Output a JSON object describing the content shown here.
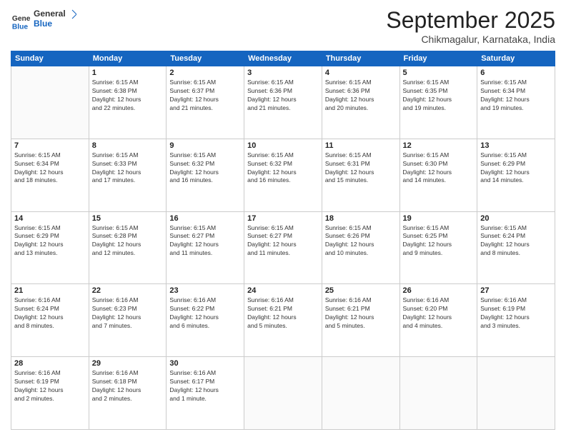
{
  "logo": {
    "line1": "General",
    "line2": "Blue"
  },
  "title": "September 2025",
  "location": "Chikmagalur, Karnataka, India",
  "days_header": [
    "Sunday",
    "Monday",
    "Tuesday",
    "Wednesday",
    "Thursday",
    "Friday",
    "Saturday"
  ],
  "weeks": [
    [
      {
        "day": "",
        "info": ""
      },
      {
        "day": "1",
        "info": "Sunrise: 6:15 AM\nSunset: 6:38 PM\nDaylight: 12 hours\nand 22 minutes."
      },
      {
        "day": "2",
        "info": "Sunrise: 6:15 AM\nSunset: 6:37 PM\nDaylight: 12 hours\nand 21 minutes."
      },
      {
        "day": "3",
        "info": "Sunrise: 6:15 AM\nSunset: 6:36 PM\nDaylight: 12 hours\nand 21 minutes."
      },
      {
        "day": "4",
        "info": "Sunrise: 6:15 AM\nSunset: 6:36 PM\nDaylight: 12 hours\nand 20 minutes."
      },
      {
        "day": "5",
        "info": "Sunrise: 6:15 AM\nSunset: 6:35 PM\nDaylight: 12 hours\nand 19 minutes."
      },
      {
        "day": "6",
        "info": "Sunrise: 6:15 AM\nSunset: 6:34 PM\nDaylight: 12 hours\nand 19 minutes."
      }
    ],
    [
      {
        "day": "7",
        "info": "Sunrise: 6:15 AM\nSunset: 6:34 PM\nDaylight: 12 hours\nand 18 minutes."
      },
      {
        "day": "8",
        "info": "Sunrise: 6:15 AM\nSunset: 6:33 PM\nDaylight: 12 hours\nand 17 minutes."
      },
      {
        "day": "9",
        "info": "Sunrise: 6:15 AM\nSunset: 6:32 PM\nDaylight: 12 hours\nand 16 minutes."
      },
      {
        "day": "10",
        "info": "Sunrise: 6:15 AM\nSunset: 6:32 PM\nDaylight: 12 hours\nand 16 minutes."
      },
      {
        "day": "11",
        "info": "Sunrise: 6:15 AM\nSunset: 6:31 PM\nDaylight: 12 hours\nand 15 minutes."
      },
      {
        "day": "12",
        "info": "Sunrise: 6:15 AM\nSunset: 6:30 PM\nDaylight: 12 hours\nand 14 minutes."
      },
      {
        "day": "13",
        "info": "Sunrise: 6:15 AM\nSunset: 6:29 PM\nDaylight: 12 hours\nand 14 minutes."
      }
    ],
    [
      {
        "day": "14",
        "info": "Sunrise: 6:15 AM\nSunset: 6:29 PM\nDaylight: 12 hours\nand 13 minutes."
      },
      {
        "day": "15",
        "info": "Sunrise: 6:15 AM\nSunset: 6:28 PM\nDaylight: 12 hours\nand 12 minutes."
      },
      {
        "day": "16",
        "info": "Sunrise: 6:15 AM\nSunset: 6:27 PM\nDaylight: 12 hours\nand 11 minutes."
      },
      {
        "day": "17",
        "info": "Sunrise: 6:15 AM\nSunset: 6:27 PM\nDaylight: 12 hours\nand 11 minutes."
      },
      {
        "day": "18",
        "info": "Sunrise: 6:15 AM\nSunset: 6:26 PM\nDaylight: 12 hours\nand 10 minutes."
      },
      {
        "day": "19",
        "info": "Sunrise: 6:15 AM\nSunset: 6:25 PM\nDaylight: 12 hours\nand 9 minutes."
      },
      {
        "day": "20",
        "info": "Sunrise: 6:15 AM\nSunset: 6:24 PM\nDaylight: 12 hours\nand 8 minutes."
      }
    ],
    [
      {
        "day": "21",
        "info": "Sunrise: 6:16 AM\nSunset: 6:24 PM\nDaylight: 12 hours\nand 8 minutes."
      },
      {
        "day": "22",
        "info": "Sunrise: 6:16 AM\nSunset: 6:23 PM\nDaylight: 12 hours\nand 7 minutes."
      },
      {
        "day": "23",
        "info": "Sunrise: 6:16 AM\nSunset: 6:22 PM\nDaylight: 12 hours\nand 6 minutes."
      },
      {
        "day": "24",
        "info": "Sunrise: 6:16 AM\nSunset: 6:21 PM\nDaylight: 12 hours\nand 5 minutes."
      },
      {
        "day": "25",
        "info": "Sunrise: 6:16 AM\nSunset: 6:21 PM\nDaylight: 12 hours\nand 5 minutes."
      },
      {
        "day": "26",
        "info": "Sunrise: 6:16 AM\nSunset: 6:20 PM\nDaylight: 12 hours\nand 4 minutes."
      },
      {
        "day": "27",
        "info": "Sunrise: 6:16 AM\nSunset: 6:19 PM\nDaylight: 12 hours\nand 3 minutes."
      }
    ],
    [
      {
        "day": "28",
        "info": "Sunrise: 6:16 AM\nSunset: 6:19 PM\nDaylight: 12 hours\nand 2 minutes."
      },
      {
        "day": "29",
        "info": "Sunrise: 6:16 AM\nSunset: 6:18 PM\nDaylight: 12 hours\nand 2 minutes."
      },
      {
        "day": "30",
        "info": "Sunrise: 6:16 AM\nSunset: 6:17 PM\nDaylight: 12 hours\nand 1 minute."
      },
      {
        "day": "",
        "info": ""
      },
      {
        "day": "",
        "info": ""
      },
      {
        "day": "",
        "info": ""
      },
      {
        "day": "",
        "info": ""
      }
    ]
  ]
}
